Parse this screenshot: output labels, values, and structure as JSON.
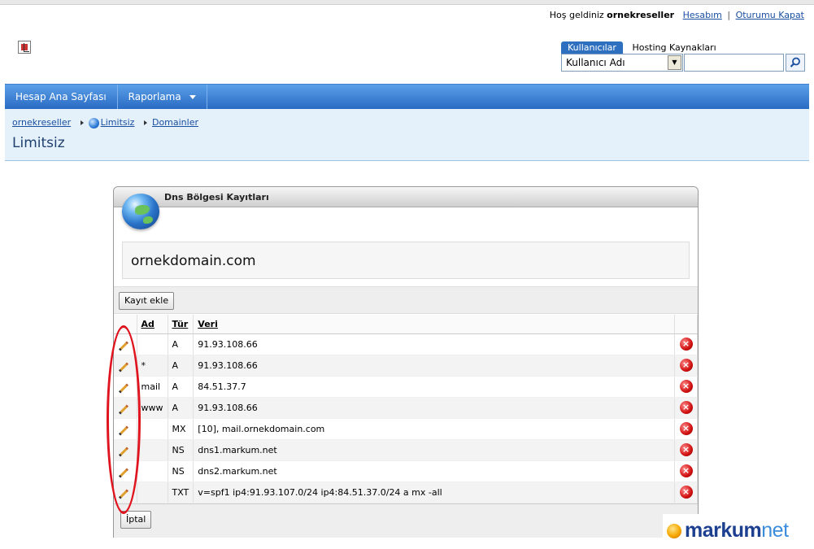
{
  "header": {
    "welcome_prefix": "Hoş geldiniz",
    "username": "ornekreseller",
    "account_link": "Hesabım",
    "separator": "|",
    "logout_link": "Oturumu Kapat"
  },
  "search": {
    "tabs": [
      {
        "label": "Kullanıcılar",
        "active": true
      },
      {
        "label": "Hosting Kaynakları",
        "active": false
      }
    ],
    "selected_field": "Kullanıcı Adı",
    "query": ""
  },
  "nav": {
    "items": [
      {
        "label": "Hesap Ana Sayfası"
      },
      {
        "label": "Raporlama"
      }
    ]
  },
  "breadcrumb": {
    "items": [
      "ornekreseller",
      "Limitsiz",
      "Domainler"
    ]
  },
  "page": {
    "title": "Limitsiz"
  },
  "panel": {
    "title": "Dns Bölgesi Kayıtları",
    "domain": "ornekdomain.com",
    "add_button": "Kayıt ekle",
    "cancel_button": "İptal"
  },
  "table": {
    "columns": [
      "Ad",
      "Tür",
      "Veri"
    ],
    "rows": [
      {
        "name": "",
        "type": "A",
        "data": "91.93.108.66"
      },
      {
        "name": "*",
        "type": "A",
        "data": "91.93.108.66"
      },
      {
        "name": "mail",
        "type": "A",
        "data": "84.51.37.7"
      },
      {
        "name": "www",
        "type": "A",
        "data": "91.93.108.66"
      },
      {
        "name": "",
        "type": "MX",
        "data": "[10], mail.ornekdomain.com"
      },
      {
        "name": "",
        "type": "NS",
        "data": "dns1.markum.net"
      },
      {
        "name": "",
        "type": "NS",
        "data": "dns2.markum.net"
      },
      {
        "name": "",
        "type": "TXT",
        "data": "v=spf1 ip4:91.93.107.0/24 ip4:84.51.37.0/24 a mx -all"
      }
    ]
  },
  "brand": {
    "name_bold": "markum",
    "name_light": "net"
  },
  "colors": {
    "nav_blue": "#2a6bc4",
    "breadcrumb_bg": "#e4f1fb",
    "annotation_red": "#e0141e"
  }
}
